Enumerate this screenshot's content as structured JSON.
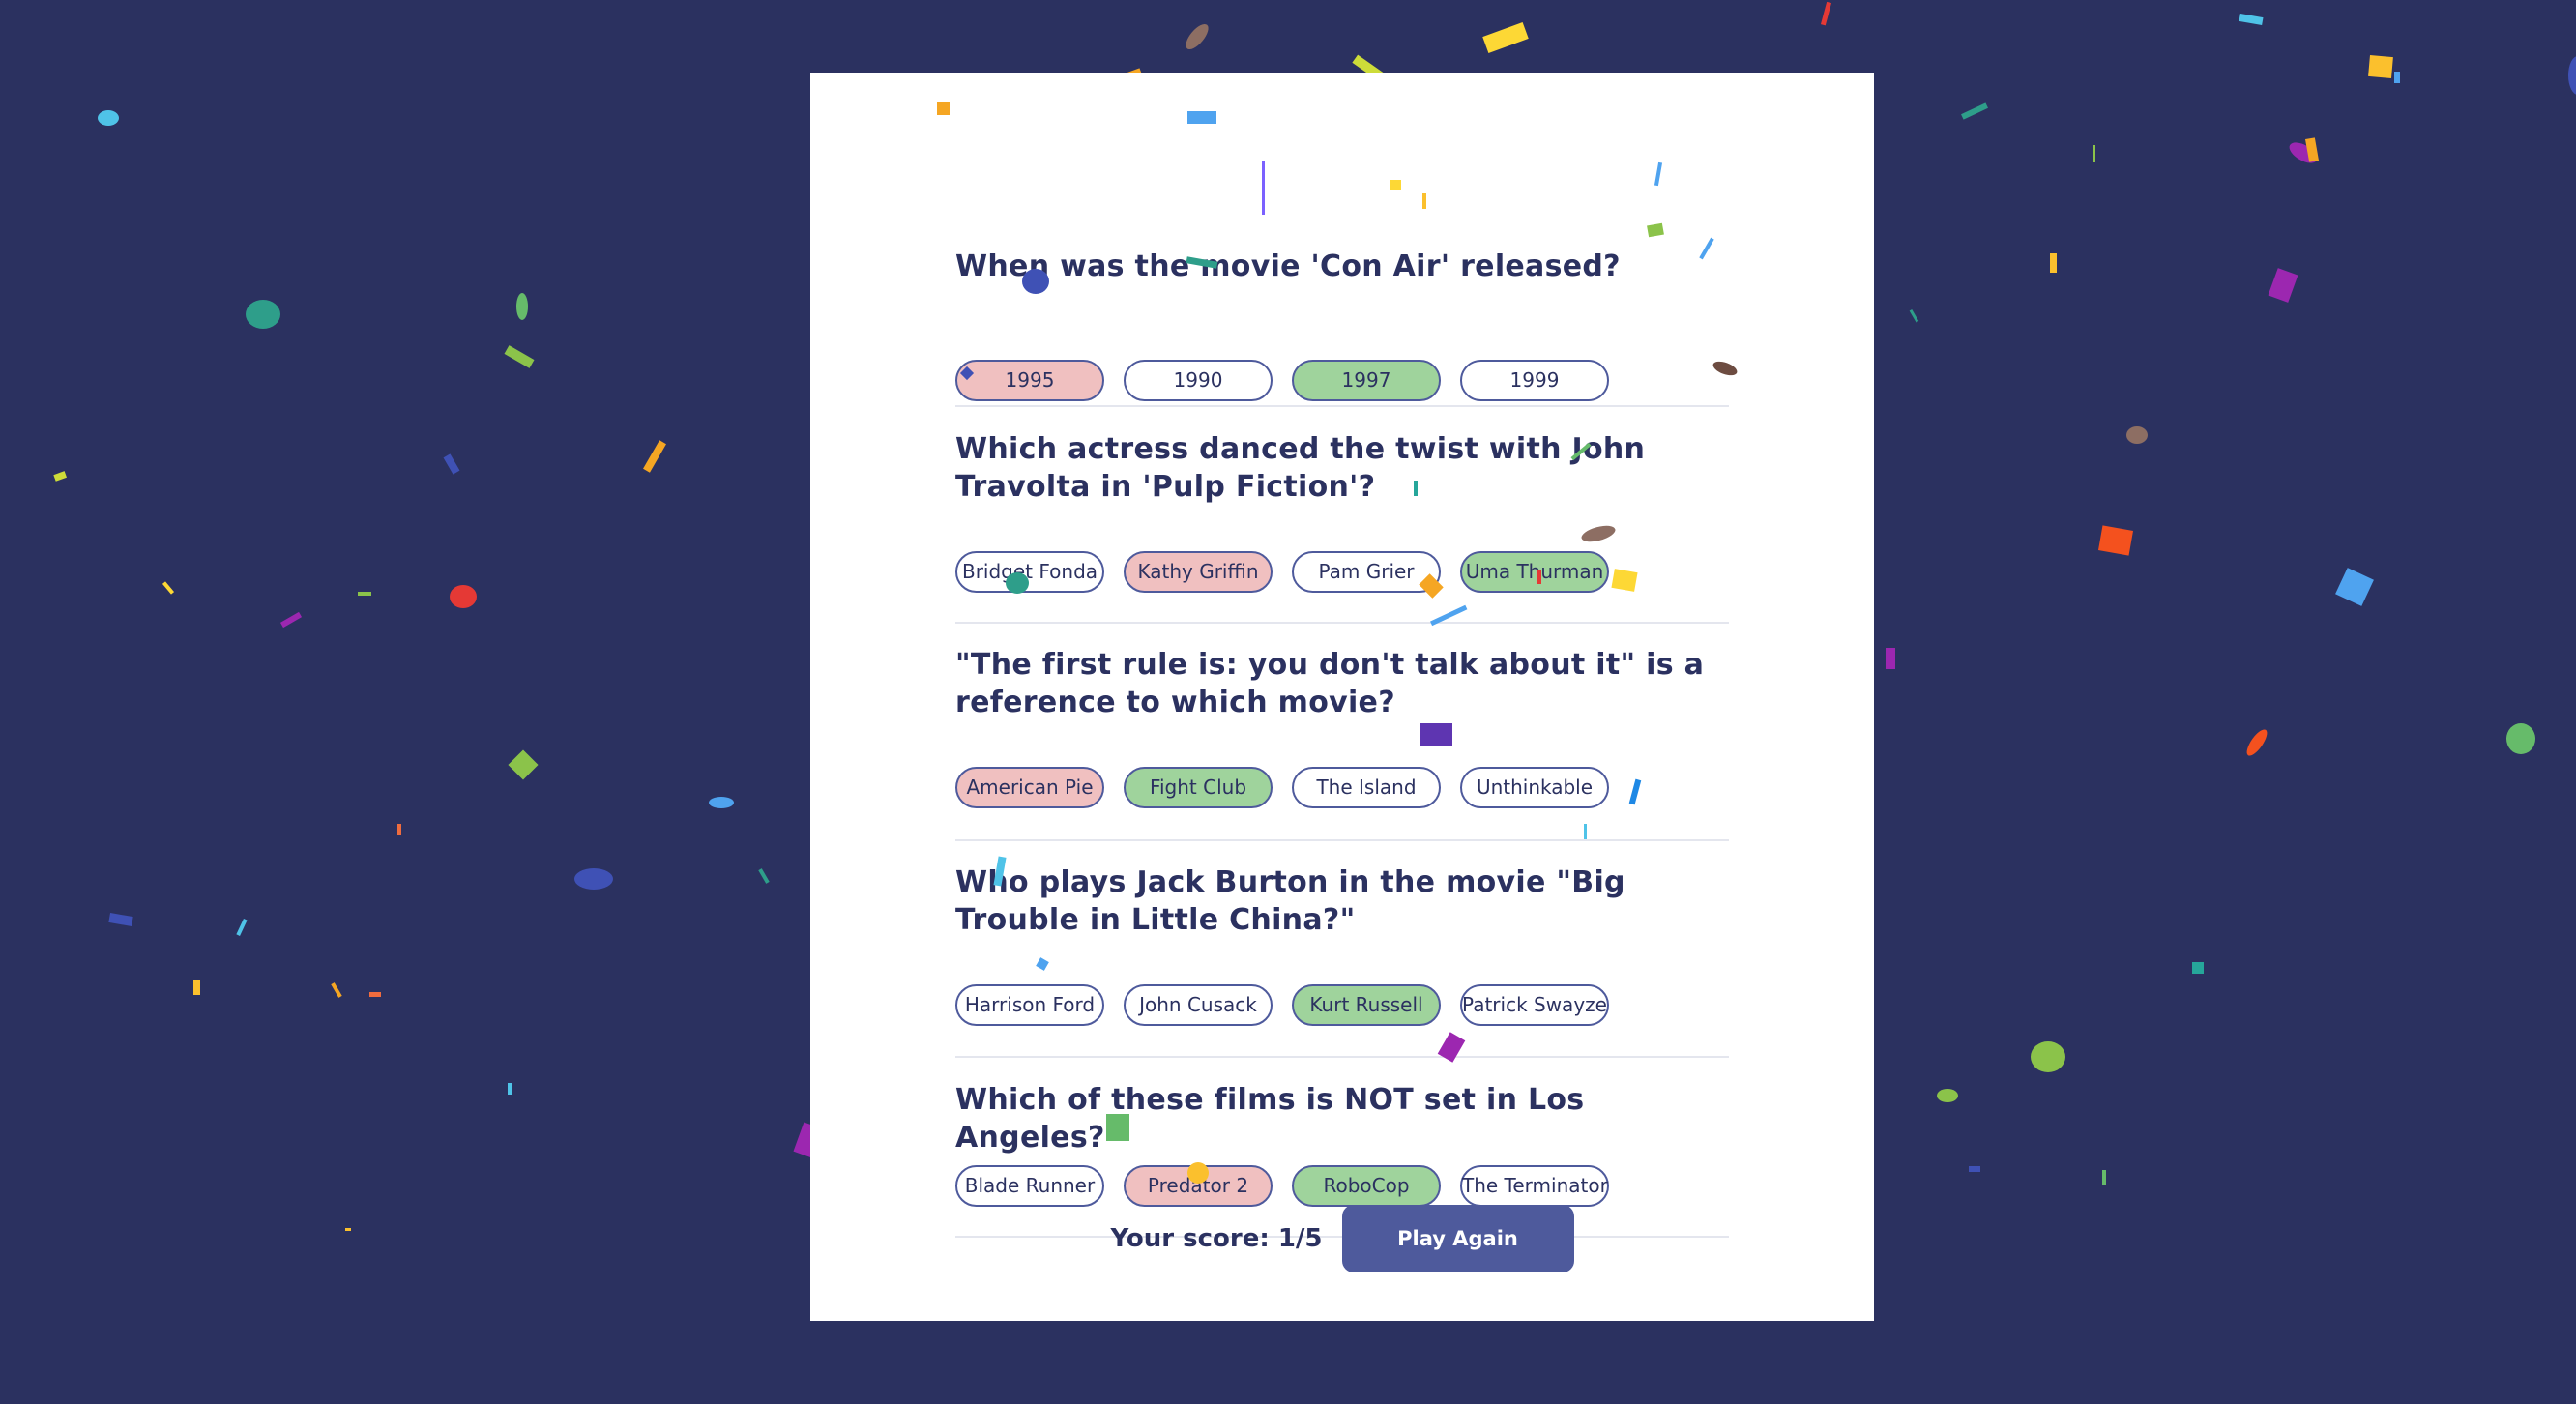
{
  "quiz": {
    "questions": [
      {
        "text": "When was the movie 'Con Air' released?",
        "answers": [
          {
            "label": "1995",
            "state": "wrong"
          },
          {
            "label": "1990",
            "state": "neutral"
          },
          {
            "label": "1997",
            "state": "correct"
          },
          {
            "label": "1999",
            "state": "neutral"
          }
        ]
      },
      {
        "text": "Which actress danced the twist with John Travolta in 'Pulp Fiction'?",
        "answers": [
          {
            "label": "Bridget Fonda",
            "state": "neutral"
          },
          {
            "label": "Kathy Griffin",
            "state": "wrong"
          },
          {
            "label": "Pam Grier",
            "state": "neutral"
          },
          {
            "label": "Uma Thurman",
            "state": "correct"
          }
        ]
      },
      {
        "text": "\"The first rule is: you don't talk about it\" is a reference to which movie?",
        "answers": [
          {
            "label": "American Pie",
            "state": "wrong"
          },
          {
            "label": "Fight Club",
            "state": "correct"
          },
          {
            "label": "The Island",
            "state": "neutral"
          },
          {
            "label": "Unthinkable",
            "state": "neutral"
          }
        ]
      },
      {
        "text": "Who plays Jack Burton in the movie \"Big Trouble in Little China?\"",
        "answers": [
          {
            "label": "Harrison Ford",
            "state": "neutral"
          },
          {
            "label": "John Cusack",
            "state": "neutral"
          },
          {
            "label": "Kurt Russell",
            "state": "correct"
          },
          {
            "label": "Patrick Swayze",
            "state": "neutral"
          }
        ]
      },
      {
        "text": "Which of these films is NOT set in Los Angeles?",
        "answers": [
          {
            "label": "Blade Runner",
            "state": "neutral"
          },
          {
            "label": "Predator 2",
            "state": "wrong"
          },
          {
            "label": "RoboCop",
            "state": "correct"
          },
          {
            "label": "The Terminator",
            "state": "neutral"
          }
        ]
      }
    ],
    "score_text": "Your score: 1/5",
    "play_again_label": "Play Again"
  },
  "colors": {
    "background": "#2b3160",
    "card": "#ffffff",
    "text": "#2b3160",
    "accent": "#4e5a9c",
    "correct": "#9fd39c",
    "wrong": "#f0c0c0"
  }
}
